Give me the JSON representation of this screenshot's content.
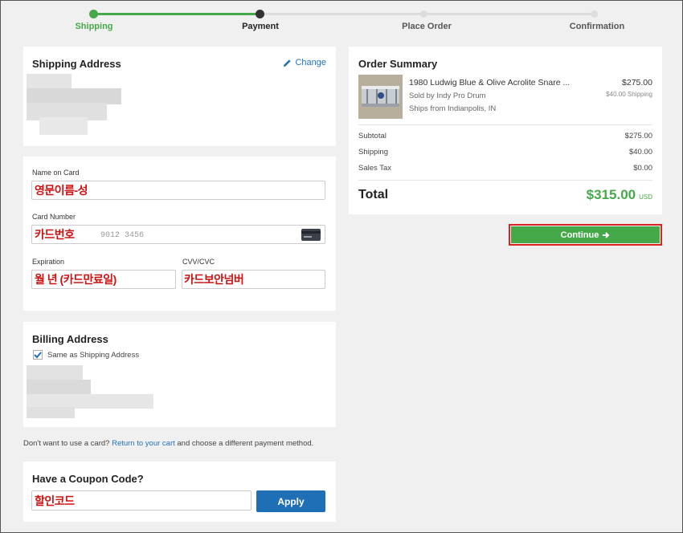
{
  "steps": [
    {
      "label": "Shipping",
      "state": "done"
    },
    {
      "label": "Payment",
      "state": "current"
    },
    {
      "label": "Place Order",
      "state": "todo"
    },
    {
      "label": "Confirmation",
      "state": "todo"
    }
  ],
  "colors": {
    "green": "#45a94a",
    "blue": "#1f6fb7",
    "red_annotation": "#cc1111"
  },
  "shipping": {
    "title": "Shipping Address",
    "change_label": "Change",
    "change_icon": "pencil-icon"
  },
  "payment": {
    "name_label": "Name on Card",
    "name_annotation": "영문이름-성",
    "card_label": "Card Number",
    "card_annotation": "카드번호",
    "card_placeholder": "9012 3456",
    "card_icon": "credit-card-icon",
    "exp_label": "Expiration",
    "exp_annotation": "월 년 (카드만료일)",
    "cvv_label": "CVV/CVC",
    "cvv_annotation": "카드보안넘버"
  },
  "billing": {
    "title": "Billing Address",
    "same_label": "Same as Shipping Address",
    "same_checked": true
  },
  "note": {
    "prefix": "Don't want to use a card?",
    "link": "Return to your cart",
    "suffix": "and choose a different payment method."
  },
  "coupon": {
    "title": "Have a Coupon Code?",
    "annotation": "할인코드",
    "apply_label": "Apply"
  },
  "summary": {
    "title": "Order Summary",
    "item": {
      "name": "1980 Ludwig Blue & Olive Acrolite Snare ...",
      "seller": "Sold by Indy Pro Drum",
      "ships": "Ships from Indianpolis, IN",
      "price": "$275.00",
      "shipping": "$40.00 Shipping"
    },
    "rows": [
      {
        "label": "Subtotal",
        "value": "$275.00"
      },
      {
        "label": "Shipping",
        "value": "$40.00"
      },
      {
        "label": "Sales Tax",
        "value": "$0.00"
      }
    ],
    "total_label": "Total",
    "total_value": "$315.00",
    "currency": "USD"
  },
  "continue_label": "Continue",
  "continue_icon": "arrow-right-icon"
}
